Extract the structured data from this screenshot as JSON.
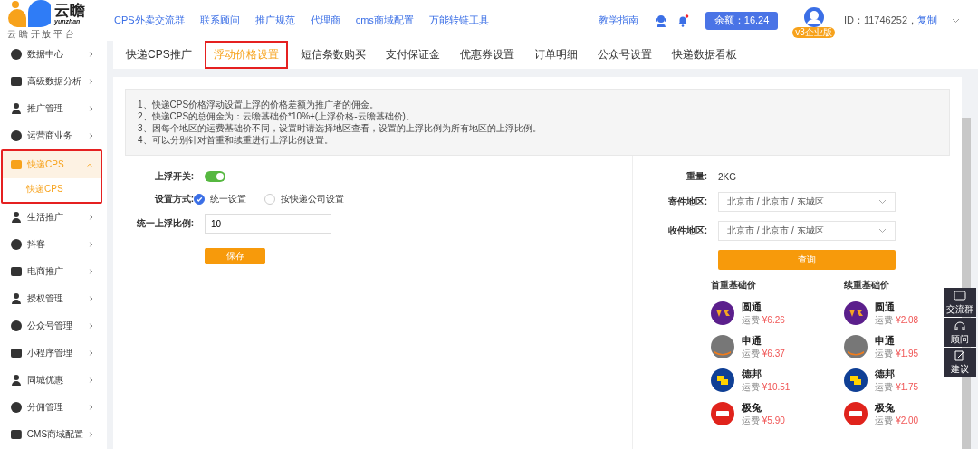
{
  "header": {
    "logo": {
      "name": "云瞻",
      "sub": "yunzhan",
      "tagline": "云 瞻 开 放 平 台"
    },
    "nav": [
      "CPS外卖交流群",
      "联系顾问",
      "推广规范",
      "代理商",
      "cms商域配置",
      "万能转链工具"
    ],
    "guide": "教学指南",
    "notification_dot": true,
    "balance": "余额：16.24",
    "badge": "v3企业版",
    "user_id": "ID：11746252，",
    "copy": "复制"
  },
  "sidebar": [
    {
      "label": "数据中心",
      "expanded": false,
      "selected": false
    },
    {
      "label": "高级数据分析",
      "expanded": false,
      "selected": false
    },
    {
      "label": "推广管理",
      "expanded": false,
      "selected": false
    },
    {
      "label": "运营商业务",
      "expanded": false,
      "selected": false
    },
    {
      "label": "快递CPS",
      "expanded": true,
      "selected": true,
      "children": [
        {
          "label": "快递CPS",
          "selected": true
        }
      ]
    },
    {
      "label": "生活推广",
      "expanded": false,
      "selected": false
    },
    {
      "label": "抖客",
      "expanded": false,
      "selected": false
    },
    {
      "label": "电商推广",
      "expanded": false,
      "selected": false
    },
    {
      "label": "授权管理",
      "expanded": false,
      "selected": false
    },
    {
      "label": "公众号管理",
      "expanded": false,
      "selected": false
    },
    {
      "label": "小程序管理",
      "expanded": false,
      "selected": false
    },
    {
      "label": "同城优惠",
      "expanded": false,
      "selected": false
    },
    {
      "label": "分佣管理",
      "expanded": false,
      "selected": false
    },
    {
      "label": "CMS商域配置",
      "expanded": false,
      "selected": false
    }
  ],
  "tabs": [
    {
      "label": "快递CPS推广",
      "selected": false
    },
    {
      "label": "浮动价格设置",
      "selected": true
    },
    {
      "label": "短信条数购买",
      "selected": false
    },
    {
      "label": "支付保证金",
      "selected": false
    },
    {
      "label": "优惠券设置",
      "selected": false
    },
    {
      "label": "订单明细",
      "selected": false
    },
    {
      "label": "公众号设置",
      "selected": false
    },
    {
      "label": "快递数据看板",
      "selected": false
    }
  ],
  "notes": [
    "1、快递CPS价格浮动设置上浮的价格差额为推广者的佣金。",
    "2、快递CPS的总佣金为：云瞻基础价*10%+(上浮价格-云瞻基础价)。",
    "3、因每个地区的运费基础价不同，设置时请选择地区查看，设置的上浮比例为所有地区的上浮比例。",
    "4、可以分别针对首重和续重进行上浮比例设置。"
  ],
  "form": {
    "switch": {
      "label": "上浮开关:",
      "on": true
    },
    "mode": {
      "label": "设置方式:",
      "options": [
        {
          "label": "统一设置",
          "selected": true
        },
        {
          "label": "按快递公司设置",
          "selected": false
        }
      ]
    },
    "ratio": {
      "label": "统一上浮比例:",
      "value": "10"
    },
    "save": "保存"
  },
  "query": {
    "weight": {
      "label": "重量:",
      "value": "2KG"
    },
    "from": {
      "label": "寄件地区:",
      "value": "北京市 / 北京市 / 东城区"
    },
    "to": {
      "label": "收件地区:",
      "value": "北京市 / 北京市 / 东城区"
    },
    "button": "查询"
  },
  "prices": [
    {
      "title": "首重基础价",
      "items": [
        {
          "name": "圆通",
          "fee": "运费",
          "price": "¥6.26",
          "color": "#5b1f8c"
        },
        {
          "name": "申通",
          "fee": "运费",
          "price": "¥6.37",
          "color": "#777777"
        },
        {
          "name": "德邦",
          "fee": "运费",
          "price": "¥10.51",
          "color": "#0f3f95"
        },
        {
          "name": "极兔",
          "fee": "运费",
          "price": "¥5.90",
          "color": "#e0231c"
        }
      ]
    },
    {
      "title": "续重基础价",
      "items": [
        {
          "name": "圆通",
          "fee": "运费",
          "price": "¥2.08",
          "color": "#5b1f8c"
        },
        {
          "name": "申通",
          "fee": "运费",
          "price": "¥1.95",
          "color": "#777777"
        },
        {
          "name": "德邦",
          "fee": "运费",
          "price": "¥1.75",
          "color": "#0f3f95"
        },
        {
          "name": "极兔",
          "fee": "运费",
          "price": "¥2.00",
          "color": "#e0231c"
        }
      ]
    }
  ],
  "float_buttons": [
    "交流群",
    "顾问",
    "建议"
  ]
}
